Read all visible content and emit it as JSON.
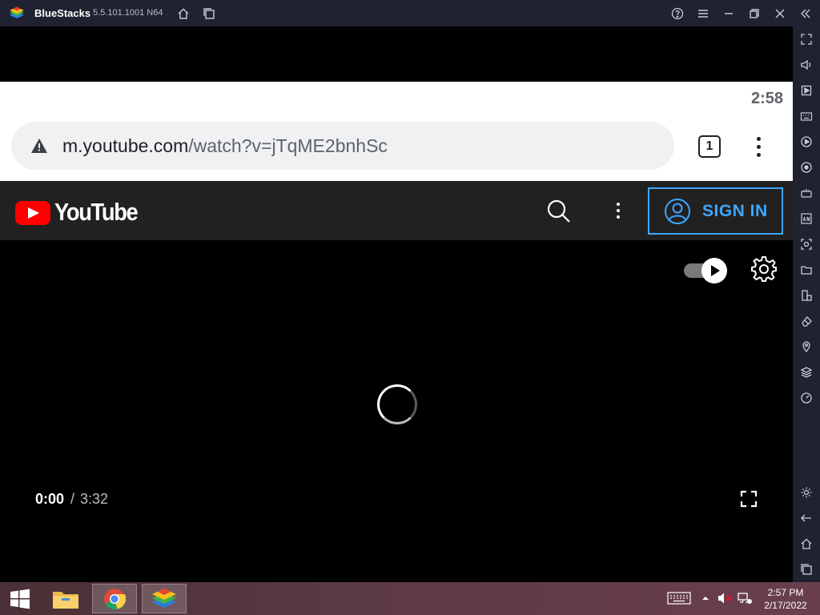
{
  "window": {
    "app_name": "BlueStacks",
    "version": "5.5.101.1001 N64"
  },
  "android": {
    "status_time": "2:58"
  },
  "browser": {
    "url_host": "m.youtube.com",
    "url_path": "/watch?v=jTqME2bnhSc",
    "tab_count": "1"
  },
  "youtube": {
    "wordmark": "YouTube",
    "sign_in_label": "SIGN IN",
    "player": {
      "current_time": "0:00",
      "separator": "/",
      "total_time": "3:32",
      "autoplay_on": true
    }
  },
  "taskbar": {
    "clock_time": "2:57 PM",
    "clock_date": "2/17/2022"
  },
  "colors": {
    "youtube_red": "#ff0000",
    "sign_in_blue": "#3ea6ff",
    "bluestacks_chrome": "#1f2230"
  }
}
